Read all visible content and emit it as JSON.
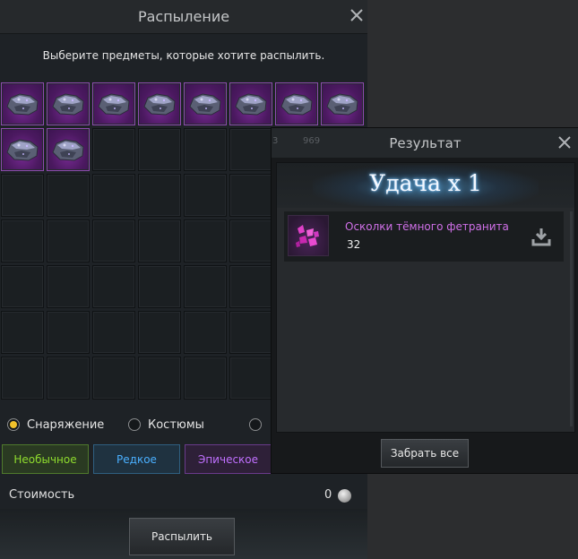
{
  "disassemble": {
    "title": "Распыление",
    "subtitle": "Выберите предметы, которые хотите распылить.",
    "filled_slots": 10,
    "total_slots": 56,
    "item_icon": "ore-chunk-icon",
    "radios": [
      {
        "label": "Снаряжение",
        "selected": true
      },
      {
        "label": "Костюмы",
        "selected": false
      },
      {
        "label": "",
        "selected": false
      }
    ],
    "filters": [
      {
        "label": "Необычное",
        "color": "#8fdc2e"
      },
      {
        "label": "Редкое",
        "color": "#4ab0ff"
      },
      {
        "label": "Эпическое",
        "color": "#c070ff"
      }
    ],
    "cost_label": "Стоимость",
    "cost_value": "0",
    "disassemble_button": "Распылить"
  },
  "background": {
    "numbers": [
      "3",
      "969"
    ]
  },
  "result": {
    "title": "Результат",
    "banner": "Удача x 1",
    "reward": {
      "name": "Осколки тёмного фетранита",
      "quantity": "32",
      "icon": "crystal-shards-icon",
      "action_icon": "download-icon"
    },
    "take_all_button": "Забрать все"
  },
  "colors": {
    "accent_selected": "#f2c22b",
    "epic_purple": "#7a2b96",
    "reward_name": "#d070e8"
  }
}
